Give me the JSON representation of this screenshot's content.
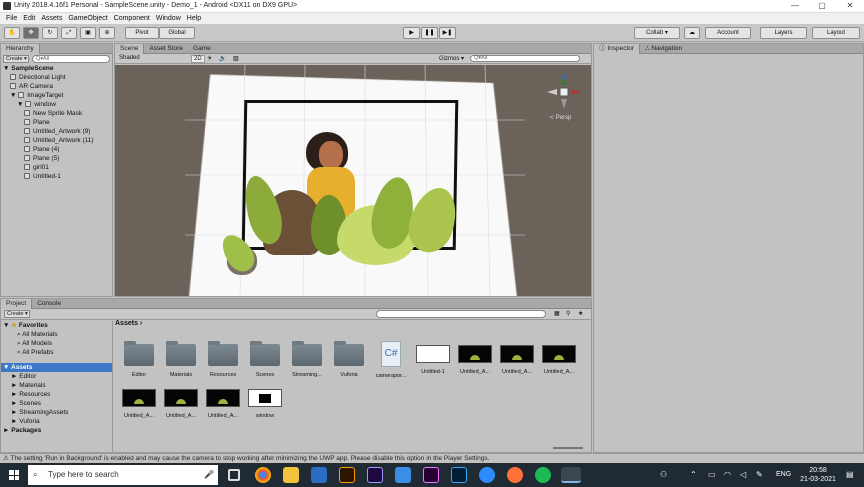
{
  "window": {
    "title": "Unity 2018.4.16f1 Personal - SampleScene.unity - Demo_1 - Android <DX11 on DX9 GPU>"
  },
  "menu": [
    "File",
    "Edit",
    "Assets",
    "GameObject",
    "Component",
    "Window",
    "Help"
  ],
  "toolbar": {
    "pivot": "Pivot",
    "global": "Global",
    "collab": "Collab ▾",
    "account": "Account",
    "layers": "Layers",
    "layout": "Layout"
  },
  "hierarchy": {
    "tab": "Hierarchy",
    "create": "Create ▾",
    "search": "Q▾All",
    "scene": "SampleScene",
    "items": [
      {
        "label": "Directional Light",
        "depth": 1
      },
      {
        "label": "AR Camera",
        "depth": 1
      },
      {
        "label": "ImageTarget",
        "depth": 1
      },
      {
        "label": "window",
        "depth": 2
      },
      {
        "label": "New Sprite Mask",
        "depth": 3
      },
      {
        "label": "Plane",
        "depth": 3
      },
      {
        "label": "Untitled_Artwork (9)",
        "depth": 3
      },
      {
        "label": "Untitled_Artwork (11)",
        "depth": 3
      },
      {
        "label": "Plane (4)",
        "depth": 3
      },
      {
        "label": "Plane (5)",
        "depth": 3
      },
      {
        "label": "girl01",
        "depth": 3
      },
      {
        "label": "Untitled-1",
        "depth": 3
      }
    ]
  },
  "scene": {
    "tabs": [
      "Scene",
      "Asset Store",
      "Game"
    ],
    "shading": "Shaded",
    "mode": "2D",
    "gizmos": "Gizmos ▾",
    "search": "Q▾All",
    "persp": "≺ Persp"
  },
  "inspector": {
    "tabs": [
      "Inspector",
      "Navigation"
    ]
  },
  "project": {
    "tabs": [
      "Project",
      "Console"
    ],
    "create": "Create ▾",
    "breadcrumb": "Assets",
    "favorites": {
      "label": "Favorites",
      "items": [
        "All Materials",
        "All Models",
        "All Prefabs"
      ]
    },
    "tree": {
      "label": "Assets",
      "items": [
        "Editor",
        "Materials",
        "Resources",
        "Scenes",
        "StreamingAssets",
        "Vuforia"
      ],
      "packages": "Packages"
    },
    "assets": [
      {
        "label": "Editor",
        "kind": "folder"
      },
      {
        "label": "Materials",
        "kind": "folder"
      },
      {
        "label": "Resources",
        "kind": "folder"
      },
      {
        "label": "Scenes",
        "kind": "folder"
      },
      {
        "label": "Streaming...",
        "kind": "folder"
      },
      {
        "label": "Vuforia",
        "kind": "folder"
      },
      {
        "label": "camerapor...",
        "kind": "script"
      },
      {
        "label": "Untitled-1",
        "kind": "white"
      },
      {
        "label": "Untitled_A...",
        "kind": "dark"
      },
      {
        "label": "Untitled_A...",
        "kind": "dark"
      },
      {
        "label": "Untitled_A...",
        "kind": "dark"
      },
      {
        "label": "Untitled_A...",
        "kind": "dark"
      },
      {
        "label": "Untitled_A...",
        "kind": "dark"
      },
      {
        "label": "Untitled_A...",
        "kind": "dark"
      },
      {
        "label": "window",
        "kind": "window"
      }
    ]
  },
  "status": "⚠ The setting 'Run in Background' is enabled and may cause the camera to stop working after minimizing the UWP app. Please disable this option in the Player Settings.",
  "taskbar": {
    "search": "Type here to search",
    "lang": "ENG",
    "time": "20:58",
    "date": "21-03-2021"
  }
}
